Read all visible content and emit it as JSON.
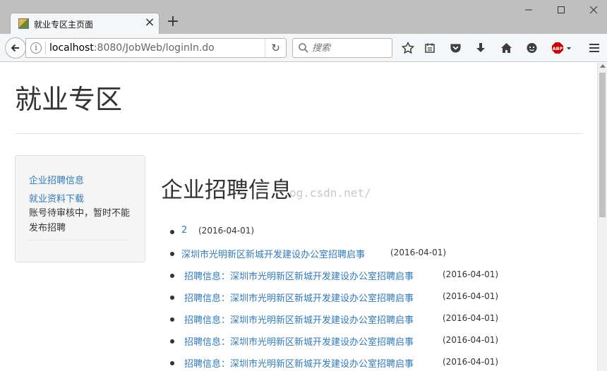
{
  "browser": {
    "tab_title": "就业专区主页面",
    "url_host": "localhost",
    "url_path": ":8080/JobWeb/loginIn.do",
    "search_placeholder": "搜索",
    "abp_label": "ABP"
  },
  "icons": {
    "new_tab": "plus-icon",
    "back": "arrow-left-icon",
    "reload": "reload-icon",
    "bookmark": "star-icon",
    "reader": "reader-icon",
    "pocket": "pocket-icon",
    "download": "download-icon",
    "home": "home-icon",
    "chat": "chat-icon",
    "menu": "hamburger-icon"
  },
  "colors": {
    "link": "#337ab7",
    "abp": "#c60000"
  },
  "page": {
    "site_title": "就业专区",
    "watermark": "og.csdn.net/",
    "sidebar": {
      "links": [
        "企业招聘信息",
        "就业资料下载"
      ],
      "note": "账号待审核中，暂时不能发布招聘"
    },
    "heading": "企业招聘信息",
    "jobs": [
      {
        "title": "2",
        "date": "(2016-04-01)"
      },
      {
        "title": "深圳市光明新区新城开发建设办公室招聘启事",
        "date": "(2016-04-01)"
      },
      {
        "title": "招聘信息：深圳市光明新区新城开发建设办公室招聘启事",
        "date": "(2016-04-01)"
      },
      {
        "title": "招聘信息：深圳市光明新区新城开发建设办公室招聘启事",
        "date": "(2016-04-01)"
      },
      {
        "title": "招聘信息：深圳市光明新区新城开发建设办公室招聘启事",
        "date": "(2016-04-01)"
      },
      {
        "title": "招聘信息：深圳市光明新区新城开发建设办公室招聘启事",
        "date": "(2016-04-01)"
      },
      {
        "title": "招聘信息：深圳市光明新区新城开发建设办公室招聘启事",
        "date": "(2016-04-01)"
      }
    ]
  }
}
